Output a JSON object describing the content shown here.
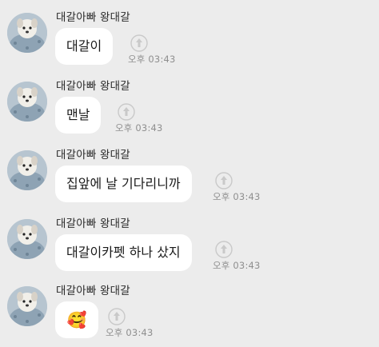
{
  "messages": [
    {
      "sender": "대갈아빠 왕대갈",
      "text": "대갈이",
      "time": "오후 03:43"
    },
    {
      "sender": "대갈아빠 왕대갈",
      "text": "맨날",
      "time": "오후 03:43"
    },
    {
      "sender": "대갈아빠 왕대갈",
      "text": "집앞에 날 기다리니까",
      "time": "오후 03:43"
    },
    {
      "sender": "대갈아빠 왕대갈",
      "text": "대갈이카펫 하나 샀지",
      "time": "오후 03:43"
    },
    {
      "sender": "대갈아빠 왕대갈",
      "text": "🥰",
      "time": "오후 03:43"
    }
  ],
  "icons": {
    "share": "share-icon",
    "avatar": "avatar"
  },
  "colors": {
    "background": "#ececec",
    "bubble": "#ffffff",
    "time_text": "#8f8f8f"
  }
}
